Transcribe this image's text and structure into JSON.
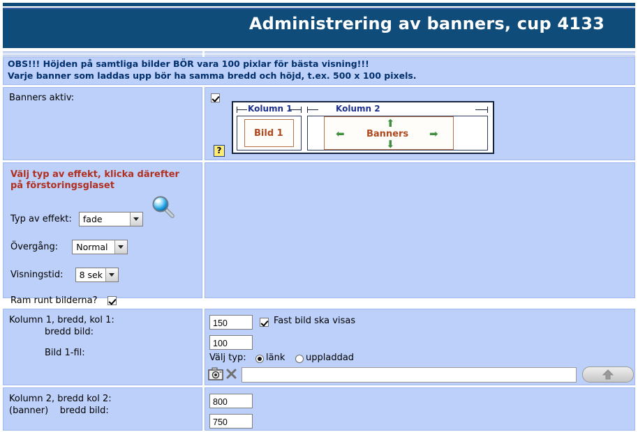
{
  "header": {
    "title": "Administrering av banners, cup 4133",
    "bg_color": "#0f4c7a",
    "text_color": "#ffffff"
  },
  "notice": {
    "line1": "OBS!!! Höjden på samtliga bilder BÖR vara 100 pixlar för bästa visning!!!",
    "line2": "Varje banner som laddas upp bör ha samma bredd och höjd, t.ex. 500 x 100 pixels.",
    "color": "#002f6c"
  },
  "rows": {
    "banners_active": {
      "label": "Banners aktiv:",
      "checkbox_checked": true,
      "help_icon": "?",
      "diagram": {
        "col1_label": "Kolumn 1",
        "col2_label": "Kolumn 2",
        "image_label": "Bild 1",
        "banner_label": "Banners",
        "arrow_up": "⬆",
        "arrow_down": "⬇",
        "arrow_left": "⬅",
        "arrow_right": "➡",
        "label_color": "#1a2f8f",
        "content_color": "#b0481f",
        "arrow_color": "#3f8f3f"
      }
    },
    "effect": {
      "title": "Välj typ av effekt, klicka därefter på förstoringsglaset",
      "title_color": "#b03020",
      "fields": [
        {
          "label": "Typ av effekt:",
          "value": "fade"
        },
        {
          "label": "Övergång:",
          "value": "Normal"
        },
        {
          "label": "Visningstid:",
          "value": "8 sek"
        }
      ],
      "frame_label": "Ram runt bilderna?",
      "frame_checked": true,
      "magnifier_icon": "magnifying-glass-icon"
    },
    "column1": {
      "label_line1": "Kolumn 1,  bredd, kol 1:",
      "label_line2": "bredd bild:",
      "label_line3": "Bild 1-fil:",
      "width_col": "150",
      "width_img": "100",
      "fixed_image_label": "Fast bild ska visas",
      "fixed_image_checked": true,
      "type_label": "Välj typ:",
      "type_options": [
        {
          "label": "länk",
          "selected": true
        },
        {
          "label": "uppladdad",
          "selected": false
        }
      ],
      "file_value": "",
      "camera_icon": "camera-icon",
      "clear_icon": "x-clear-icon",
      "upload_icon": "upload-arrow-icon"
    },
    "column2": {
      "label_line1": "Kolumn 2,  bredd kol 2:",
      "label_line2": "(banner)    bredd bild:",
      "width_col": "800",
      "width_img": "750"
    }
  }
}
